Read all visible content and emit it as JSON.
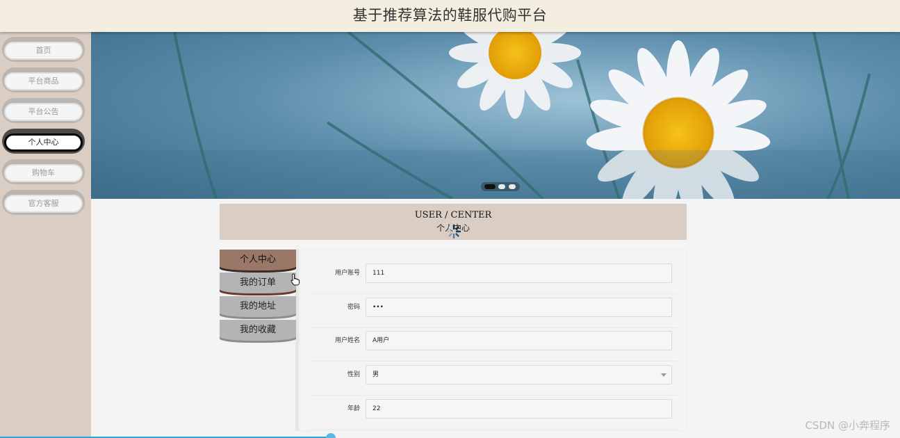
{
  "header": {
    "title": "基于推荐算法的鞋服代购平台"
  },
  "sidebar": {
    "items": [
      {
        "label": "首页",
        "active": false
      },
      {
        "label": "平台商品",
        "active": false
      },
      {
        "label": "平台公告",
        "active": false
      },
      {
        "label": "个人中心",
        "active": true
      },
      {
        "label": "购物车",
        "active": false
      },
      {
        "label": "官方客服",
        "active": false
      }
    ]
  },
  "banner": {
    "slides": 3,
    "current_slide": 1
  },
  "user_center": {
    "title_en": "USER / CENTER",
    "title_cn": "个人中心"
  },
  "menu": {
    "items": [
      {
        "label": "个人中心",
        "active": true
      },
      {
        "label": "我的订单",
        "active": false
      },
      {
        "label": "我的地址",
        "active": false
      },
      {
        "label": "我的收藏",
        "active": false
      }
    ]
  },
  "form": {
    "fields": [
      {
        "label": "用户账号",
        "value": "111",
        "type": "text"
      },
      {
        "label": "密码",
        "value": "•••",
        "type": "password"
      },
      {
        "label": "用户姓名",
        "value": "A用户",
        "type": "text"
      },
      {
        "label": "性别",
        "value": "男",
        "type": "select"
      },
      {
        "label": "年龄",
        "value": "22",
        "type": "text"
      }
    ]
  },
  "watermark": "CSDN @小奔程序",
  "colors": {
    "header_bg": "#f3eee0",
    "sidebar_bg": "#d9cdc4",
    "menu_active": "#9a7868",
    "menu_item": "#b4b4b4"
  }
}
